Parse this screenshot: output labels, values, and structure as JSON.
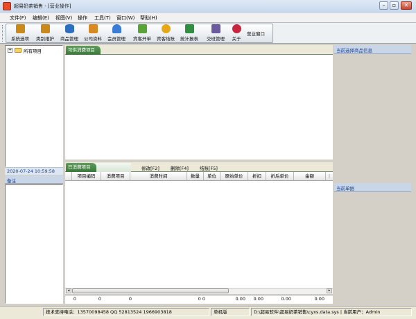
{
  "window": {
    "title": "超易奶茶销售 - [营业操作]",
    "minimize_glyph": "–",
    "restore_glyph": "▫",
    "close_glyph": "✕"
  },
  "menu": [
    "文件(F)",
    "编辑(E)",
    "视图(V)",
    "操作",
    "工具(T)",
    "窗口(W)",
    "帮助(H)"
  ],
  "toolbar": [
    {
      "label": "系统选项",
      "icon": "hand-tool-icon",
      "color": "#c98a1a"
    },
    {
      "label": "类别维护",
      "icon": "hand-category-icon",
      "color": "#c98a1a"
    },
    {
      "label": "商品管理",
      "icon": "database-icon",
      "color": "#2c6fbf"
    },
    {
      "label": "公司资料",
      "icon": "company-icon",
      "color": "#d88a22"
    },
    {
      "label": "会员管理",
      "icon": "member-icon",
      "color": "#3a7bd5"
    },
    {
      "label": "宾客开单",
      "icon": "gift-box-icon",
      "color": "#5aa336"
    },
    {
      "label": "宾客结账",
      "icon": "coin-icon",
      "color": "#e6a817"
    },
    {
      "label": "统计报表",
      "icon": "bar-chart-icon",
      "color": "#2f8e3f"
    },
    {
      "label": "交班管理",
      "icon": "shift-handover-icon",
      "color": "#6b5a9e"
    },
    {
      "label": "关于",
      "icon": "question-icon",
      "color": "#c7263e"
    },
    {
      "label": "营业窗口",
      "icon": "",
      "color": ""
    }
  ],
  "tree": {
    "expander": "+",
    "root_label": "所有项目"
  },
  "datetime": "2020-07-24 10:59:58",
  "notes": {
    "title": "备注"
  },
  "available": {
    "tab_label": "可供消费项目"
  },
  "consumed": {
    "tab_label": "已消费项目",
    "actions": [
      "修改[F2]",
      "删除[F4]",
      "结账[F5]"
    ],
    "columns": [
      "项目编码",
      "消费项目",
      "消费时间",
      "数量",
      "单位",
      "原始单价",
      "折扣",
      "折后单价",
      "金额"
    ],
    "totals": [
      "0",
      "0",
      "0",
      "0 0",
      "0.00",
      "0.00",
      "0.00",
      "0.00"
    ]
  },
  "scroll": {
    "left_glyph": "◂",
    "right_glyph": "▸"
  },
  "right_panel": {
    "info_title": "当前选择商品信息",
    "bill_title": "当前单据"
  },
  "status": {
    "support": "技术支持电话：13570098458 QQ 52813524 1966903818",
    "mode": "单机版",
    "path": "D:\\超易软件\\超易奶茶销售\\cyxs.data.sys | 当前用户：Admin"
  }
}
